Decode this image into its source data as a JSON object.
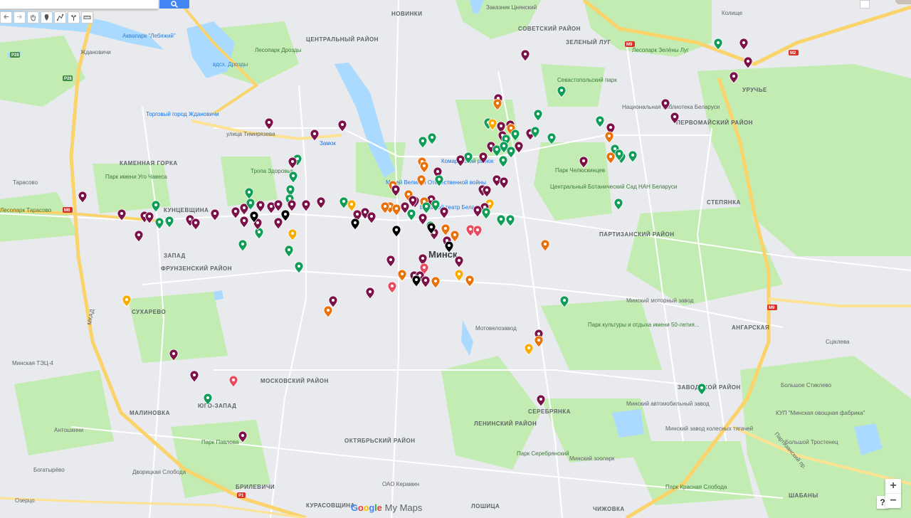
{
  "app": {
    "brand_letters": [
      "G",
      "o",
      "o",
      "g",
      "l",
      "e"
    ],
    "product": "My Maps"
  },
  "search": {
    "value": "",
    "placeholder": ""
  },
  "toolbar": {
    "tools": [
      {
        "icon": "undo-icon"
      },
      {
        "icon": "redo-icon"
      },
      {
        "icon": "hand-pan-icon"
      },
      {
        "icon": "add-marker-icon"
      },
      {
        "icon": "draw-line-icon"
      },
      {
        "icon": "directions-icon"
      },
      {
        "icon": "ruler-icon"
      }
    ]
  },
  "zoom": {
    "in": "+",
    "out": "−"
  },
  "help": {
    "label": "?"
  },
  "colors": {
    "water": "#aadaff",
    "park": "#c3ecb2",
    "land": "#e8eaed",
    "road": "#ffffff",
    "highway": "#fde293",
    "marker_purple": "#7b1149",
    "marker_green": "#0f9d58",
    "marker_orange": "#e8710a",
    "marker_yellow": "#f9ab00",
    "marker_red": "#e84c60",
    "marker_black": "#000000"
  },
  "map": {
    "labels": [
      {
        "text": "Заказник Цнянский",
        "kind": "park"
      },
      {
        "text": "НОВИНКИ",
        "kind": "district"
      },
      {
        "text": "СОВЕТСКИЙ РАЙОН",
        "kind": "district"
      },
      {
        "text": "ЗЕЛЕНЫЙ ЛУГ",
        "kind": "district"
      },
      {
        "text": "Лесопарк Зелёны Луг",
        "kind": "park"
      },
      {
        "text": "Колище",
        "kind": "place"
      },
      {
        "text": "Аквапарк \"Лебяжий\"",
        "kind": "poi"
      },
      {
        "text": "ЦЕНТРАЛЬНЫЙ РАЙОН",
        "kind": "district"
      },
      {
        "text": "Ждановичи",
        "kind": "place"
      },
      {
        "text": "Лесопарк Дрозды",
        "kind": "park"
      },
      {
        "text": "вдсх. Дрозды",
        "kind": "water"
      },
      {
        "text": "Севастопольский парк",
        "kind": "park"
      },
      {
        "text": "УРУЧЬЕ",
        "kind": "district"
      },
      {
        "text": "Национальная библиотека Беларуси",
        "kind": "poi"
      },
      {
        "text": "ПЕРВОМАЙСКИЙ РАЙОН",
        "kind": "district"
      },
      {
        "text": "Торговый город Ждановичи",
        "kind": "poi"
      },
      {
        "text": "улица Тимирязева",
        "kind": "road"
      },
      {
        "text": "Замок",
        "kind": "poi"
      },
      {
        "text": "Комаровский рынок",
        "kind": "poi"
      },
      {
        "text": "КАМЕННАЯ ГОРКА",
        "kind": "district"
      },
      {
        "text": "Тропа Здоровья",
        "kind": "park"
      },
      {
        "text": "Парк имени Уго Чавеса",
        "kind": "park"
      },
      {
        "text": "Тарасово",
        "kind": "place"
      },
      {
        "text": "Музей Великой Отечественной войны",
        "kind": "poi"
      },
      {
        "text": "Большой театр Беларуси",
        "kind": "poi"
      },
      {
        "text": "Парк Челюскинцев",
        "kind": "park"
      },
      {
        "text": "Центральный Ботанический Сад НАН Беларуси",
        "kind": "park"
      },
      {
        "text": "СТЕПЯНКА",
        "kind": "district"
      },
      {
        "text": "Лесопарк Тарасово",
        "kind": "park"
      },
      {
        "text": "КУНЦЕВЩИНА",
        "kind": "district"
      },
      {
        "text": "ПАРТИЗАНСКИЙ РАЙОН",
        "kind": "district"
      },
      {
        "text": "ЗАПАД",
        "kind": "district"
      },
      {
        "text": "ФРУНЗЕНСКИЙ РАЙОН",
        "kind": "district"
      },
      {
        "text": "Минск",
        "kind": "city"
      },
      {
        "text": "Минский моторный завод",
        "kind": "poi"
      },
      {
        "text": "СУХАРЕВО",
        "kind": "district"
      },
      {
        "text": "Мотовелозавод",
        "kind": "poi"
      },
      {
        "text": "Парк культуры и отдыха имени 50-летия...",
        "kind": "park"
      },
      {
        "text": "АНГАРСКАЯ",
        "kind": "district"
      },
      {
        "text": "Сцiклева",
        "kind": "place"
      },
      {
        "text": "Минская ТЭЦ-4",
        "kind": "poi"
      },
      {
        "text": "МОСКОВСКИЙ РАЙОН",
        "kind": "district"
      },
      {
        "text": "ЗАВОДСКОЙ РАЙОН",
        "kind": "district"
      },
      {
        "text": "Большое Стиклево",
        "kind": "place"
      },
      {
        "text": "ЮГО-ЗАПАД",
        "kind": "district"
      },
      {
        "text": "МАЛИНОВКА",
        "kind": "district"
      },
      {
        "text": "СЕРЕБРЯНКА",
        "kind": "district"
      },
      {
        "text": "Минский автомобильный завод",
        "kind": "poi"
      },
      {
        "text": "КУП \"Минская овощная фабрика\"",
        "kind": "poi"
      },
      {
        "text": "Антошкини",
        "kind": "place"
      },
      {
        "text": "ЛЕНИНСКИЙ РАЙОН",
        "kind": "district"
      },
      {
        "text": "Минский завод колесных тягачей",
        "kind": "poi"
      },
      {
        "text": "Парк Павлова",
        "kind": "park"
      },
      {
        "text": "ОКТЯБРЬСКИЙ РАЙОН",
        "kind": "district"
      },
      {
        "text": "Парк Серебрянский",
        "kind": "park"
      },
      {
        "text": "Минский зоопарк",
        "kind": "poi"
      },
      {
        "text": "Большой Тростенец",
        "kind": "place"
      },
      {
        "text": "Богатырёво",
        "kind": "place"
      },
      {
        "text": "Дворицкая Слобода",
        "kind": "place"
      },
      {
        "text": "БРИЛЕВИЧИ",
        "kind": "district"
      },
      {
        "text": "ОАО Керамин",
        "kind": "poi"
      },
      {
        "text": "Озерцо",
        "kind": "place"
      },
      {
        "text": "КУРАСОВЩИНА",
        "kind": "district"
      },
      {
        "text": "Парк Красная Слобода",
        "kind": "park"
      },
      {
        "text": "ШАБАНЫ",
        "kind": "district"
      },
      {
        "text": "ЛОШИЦА",
        "kind": "district"
      },
      {
        "text": "ЧИЖОВКА",
        "kind": "district"
      },
      {
        "text": "МКАД",
        "kind": "road"
      },
      {
        "text": "Партизанский пр.",
        "kind": "road"
      }
    ],
    "route_shields": [
      "Р28",
      "М9",
      "М1",
      "М4",
      "М2",
      "Р1",
      "M6"
    ]
  }
}
